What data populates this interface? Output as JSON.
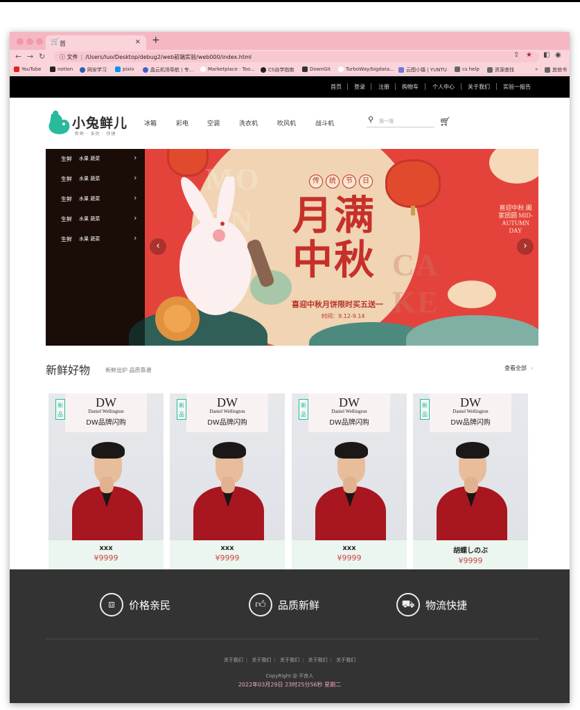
{
  "browser": {
    "tab_title": "首",
    "tab_close": "×",
    "new_tab": "+",
    "url_prefix": "文件",
    "url": "/Users/luo/Desktop/debug2/web前端实验/web000/index.html",
    "bookmarks": [
      {
        "label": "YouTube",
        "color": "#e62117"
      },
      {
        "label": "notion",
        "color": "#222222"
      },
      {
        "label": "网安学习",
        "color": "#2b5fb4"
      },
      {
        "label": "pixiv",
        "color": "#0096fa"
      },
      {
        "label": "晶云机场导航 | 专...",
        "color": "#4062c8"
      },
      {
        "label": "Marketplace · Too...",
        "color": "#f4b9c3"
      },
      {
        "label": "CS自学指南",
        "color": "#222222"
      },
      {
        "label": "DownGit",
        "color": "#333333"
      },
      {
        "label": "TurboWay/bigdata...",
        "color": "#f4b9c3"
      },
      {
        "label": "云图小镇 | YUNTU",
        "color": "#6b7bd6"
      },
      {
        "label": "cs help",
        "color": "#555555"
      },
      {
        "label": "资源查找",
        "color": "#555555"
      }
    ],
    "bookmarks_more": "»",
    "bookmarks_other": "其他书"
  },
  "topnav": [
    "首页",
    "登录",
    "注册",
    "购物车",
    "个人中心",
    "关于我们",
    "实验一报告"
  ],
  "logo": {
    "title": "小兔鲜儿",
    "subtitle": "新鲜 · 亲民 · 快捷"
  },
  "categories": [
    "冰箱",
    "彩电",
    "空调",
    "洗衣机",
    "吹风机",
    "战斗机"
  ],
  "search": {
    "placeholder": "搜一搜"
  },
  "side_menu": [
    {
      "primary": "生鲜",
      "secondary": "水果 蔬菜"
    },
    {
      "primary": "生鲜",
      "secondary": "水果 蔬菜"
    },
    {
      "primary": "生鲜",
      "secondary": "水果 蔬菜"
    },
    {
      "primary": "生鲜",
      "secondary": "水果 蔬菜"
    },
    {
      "primary": "生鲜",
      "secondary": "水果 蔬菜"
    }
  ],
  "banner": {
    "tags": [
      "传",
      "统",
      "节",
      "日"
    ],
    "title_line1": "月满",
    "title_line2": "中秋",
    "promo": "喜迎中秋月饼限时买五送一",
    "date": "时间：9.12-9.14",
    "ghost_text_1": "MO",
    "ghost_text_2": "ON",
    "ghost_text_3": "CA",
    "ghost_text_4": "KE",
    "right_text": "喜迎中秋 阖家团圆 MID-AUTUMN DAY",
    "prev": "‹",
    "next": "›"
  },
  "section": {
    "title": "新鲜好物",
    "subtitle": "新鲜出炉 品质靠谱",
    "more": "查看全部",
    "more_arrow": "›"
  },
  "products": [
    {
      "badge": "新品",
      "brand": "DW",
      "brand_full": "Daniel Wellington",
      "flash": "DW品牌闪购",
      "name": "xxx",
      "price": "¥9999"
    },
    {
      "badge": "新品",
      "brand": "DW",
      "brand_full": "Daniel Wellington",
      "flash": "DW品牌闪购",
      "name": "xxx",
      "price": "¥9999"
    },
    {
      "badge": "新品",
      "brand": "DW",
      "brand_full": "Daniel Wellington",
      "flash": "DW品牌闪购",
      "name": "xxx",
      "price": "¥9999"
    },
    {
      "badge": "新品",
      "brand": "DW",
      "brand_full": "Daniel Wellington",
      "flash": "DW品牌闪购",
      "name": "胡蝶しのぶ",
      "price": "¥9999"
    }
  ],
  "features": [
    {
      "label": "价格亲民",
      "icon": "box-icon"
    },
    {
      "label": "品质新鲜",
      "icon": "thumbs-up-icon"
    },
    {
      "label": "物流快捷",
      "icon": "truck-icon"
    }
  ],
  "footer": {
    "links": [
      "关于我们",
      "关于我们",
      "关于我们",
      "关于我们",
      "关于我们"
    ],
    "copyright": "CopyRight @ 不良人",
    "time": "2022年03月29日 23时25分56秒 星期二"
  },
  "colors": {
    "brand_green": "#27ba9b",
    "price_red": "#cf4444",
    "chrome_pink": "#f5b8c2",
    "footer_bg": "#333333"
  }
}
